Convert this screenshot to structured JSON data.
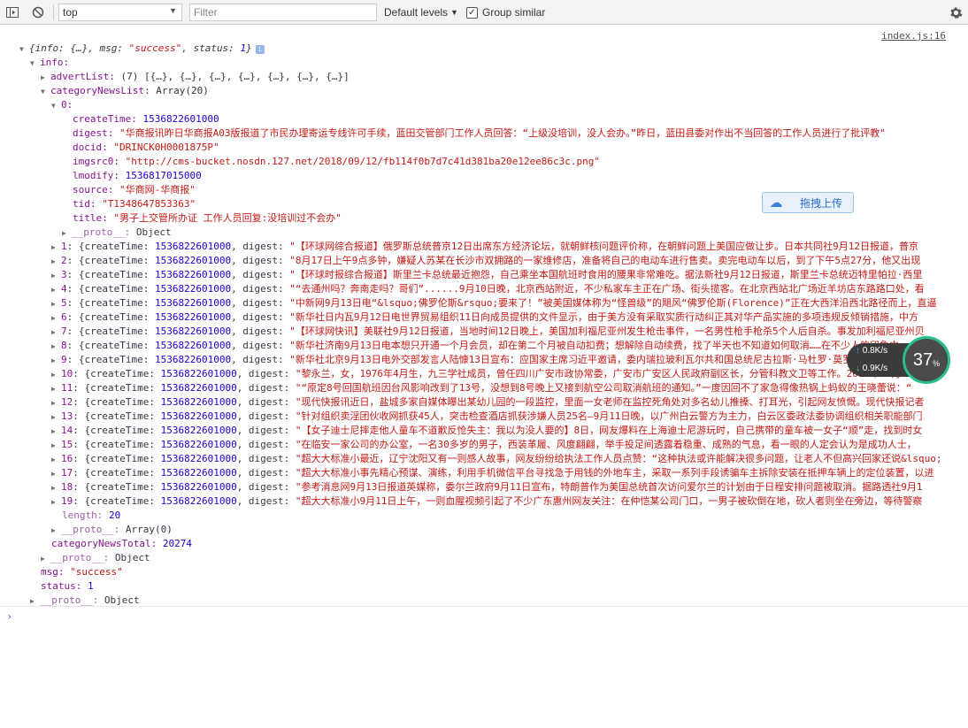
{
  "toolbar": {
    "context": "top",
    "filter_placeholder": "Filter",
    "levels": "Default levels",
    "group_similar": "Group similar"
  },
  "source_link": "index.js:16",
  "log": {
    "summary_open": "{info: {…}, msg: ",
    "summary_msg": "\"success\"",
    "summary_mid": ", status: ",
    "summary_status": "1",
    "summary_close": "}",
    "info_key": "info:",
    "advert_key": "advertList:",
    "advert_val": " (7) [{…}, {…}, {…}, {…}, {…}, {…}, {…}]",
    "category_key": "categoryNewsList:",
    "category_val": " Array(20)",
    "item0_key": "0:",
    "item0": [
      {
        "k": "createTime:",
        "v": "1536822601000",
        "t": "num"
      },
      {
        "k": "digest:",
        "v": "\"华商报讯昨日华商报A03版报道了市民办理寄运专线许可手续，蓝田交管部门工作人员回答：“上级没培训，没人会办。”昨日，蓝田县委对作出不当回答的工作人员进行了批评教\"",
        "t": "str"
      },
      {
        "k": "docid:",
        "v": "\"DRINCK0H0001875P\"",
        "t": "str"
      },
      {
        "k": "imgsrc0:",
        "v": "\"http://cms-bucket.nosdn.127.net/2018/09/12/fb114f0b7d7c41d381ba20e12ee86c3c.png\"",
        "t": "str"
      },
      {
        "k": "lmodify:",
        "v": "1536817015000",
        "t": "num"
      },
      {
        "k": "source:",
        "v": "\"华商网-华商报\"",
        "t": "str"
      },
      {
        "k": "tid:",
        "v": "\"T1348647853363\"",
        "t": "str"
      },
      {
        "k": "title:",
        "v": "\"男子上交管所办证 工作人员回复:没培训过不会办\"",
        "t": "str"
      }
    ],
    "proto_key": "__proto__:",
    "proto_object": " Object",
    "proto_array": " Array(0)",
    "collapsed_prefix": ": {createTime: ",
    "collapsed_time": "1536822601000",
    "collapsed_mid": ", digest: ",
    "items": [
      {
        "i": "1",
        "d": "\"【环球网综合报道】俄罗斯总统普京12日出席东方经济论坛，就朝鲜核问题评价称，在朝鲜问题上美国应做让步。日本共同社9月12日报道，普京"
      },
      {
        "i": "2",
        "d": "\"8月17日上午9点多钟，嫌疑人苏某在长沙市双拥路的一家维修店，准备将自己的电动车进行售卖。卖完电动车以后，到了下午5点27分，他又出现"
      },
      {
        "i": "3",
        "d": "\"【环球时报综合报道】斯里兰卡总统最近抱怨，自己乘坐本国航班时食用的腰果非常难吃。据法新社9月12日报道，斯里兰卡总统迈特里帕拉·西里"
      },
      {
        "i": "4",
        "d": "\"“去通州吗？奔南走吗？哥们”......9月10日晚，北京西站附近，不少私家车主正在广场、街头揽客。在北京西站北广场近羊坊店东路路口处，看"
      },
      {
        "i": "5",
        "d": "\"中新网9月13日电“&lsquo;佛罗伦斯&rsquo;要来了！”被美国媒体称为“怪兽级”的飓风“佛罗伦斯(Florence)”正在大西洋沿西北路径而上，直逼"
      },
      {
        "i": "6",
        "d": "\"新华社日内瓦9月12日电世界贸易组织11日向成员提供的文件显示，由于美方没有采取实质行动纠正其对华产品实施的多项违规反倾销措施，中方"
      },
      {
        "i": "7",
        "d": "\"【环球网快讯】美联社9月12日报道，当地时间12日晚上，美国加利福尼亚州发生枪击事件，一名男性枪手枪杀5个人后自杀。事发加利福尼亚州贝"
      },
      {
        "i": "8",
        "d": "\"新华社济南9月13日电本想只开通一个月会员，却在第二个月被自动扣费；想解除自动续费，找了半天也不知道如何取消……在不少人的印象中，"
      },
      {
        "i": "9",
        "d": "\"新华社北京9月13日电外交部发言人陆慷13日宣布：应国家主席习近平邀请，委内瑞拉玻利瓦尔共和国总统尼古拉斯·马杜罗·莫罗斯将于9月13日"
      },
      {
        "i": "10",
        "d": "\"黎永兰，女，1976年4月生，九三学社成员，曾任四川广安市政协常委，广安市广安区人民政府副区长，分管科教文卫等工作。2017年10月"
      },
      {
        "i": "11",
        "d": "\"“原定8号回国航班因台风影响改到了13号，没想到8号晚上又接到航空公司取消航班的通知。”一度因回不了家急得像热锅上蚂蚁的王晓蕾说：“"
      },
      {
        "i": "12",
        "d": "\"现代快报讯近日，盐城多家自媒体曝出某幼儿园的一段监控，里面一女老师在监控死角处对多名幼儿推搡、打耳光，引起网友愤慨。现代快报记者"
      },
      {
        "i": "13",
        "d": "\"针对组织卖淫团伙收网抓获45人，突击检查酒店抓获涉嫌人员25名—9月11日晚，以广州白云警方为主力，白云区委政法委协调组织相关职能部门"
      },
      {
        "i": "14",
        "d": "\"【女子迪士尼摔走他人童车不道歉反怆失主：我以为没人要的】8日，网友爆料在上海迪士尼游玩时，自己携带的童车被一女子“顺”走，找到时女"
      },
      {
        "i": "15",
        "d": "\"在临安一家公司的办公室，一名30多岁的男子，西装革履、风度翩翩，举手投足间透露着稳重、成熟的气息，看一眼的人定会认为是成功人士，"
      },
      {
        "i": "16",
        "d": "\"超大大标准小最近，辽宁沈阳又有一则感人故事，网友纷纷给执法工作人员点赞：“这种执法或许能解决很多问题，让老人不但高兴回家还说&lsquo;"
      },
      {
        "i": "17",
        "d": "\"超大大标准小事先精心预谋、演练，利用手机微信平台寻找急于用钱的外地车主，采取一系列手段诱骗车主拆除安装在抵押车辆上的定位装置，以进"
      },
      {
        "i": "18",
        "d": "\"参考消息网9月13日报道英媒称，委尔兰政府9月11日宣布，特朗普作为美国总统首次访问爱尔兰的计划由于日程安排问题被取消。据路透社9月1"
      },
      {
        "i": "19",
        "d": "\"超大大标准小9月11日上午，一则血腥视频引起了不少广东惠州网友关注：在仲恺某公司门口，一男子被砍倒在地，砍人者则坐在旁边，等待警察"
      }
    ],
    "length_key": "length:",
    "length_val": "20",
    "total_key": "categoryNewsTotal:",
    "total_val": "20274",
    "msg_key": "msg:",
    "msg_val": "\"success\"",
    "status_key": "status:",
    "status_val": "1"
  },
  "overlay": {
    "upload_label": "拖拽上传",
    "up_rate": "0.8K/s",
    "down_rate": "0.9K/s",
    "percent": "37",
    "percent_unit": "%"
  }
}
